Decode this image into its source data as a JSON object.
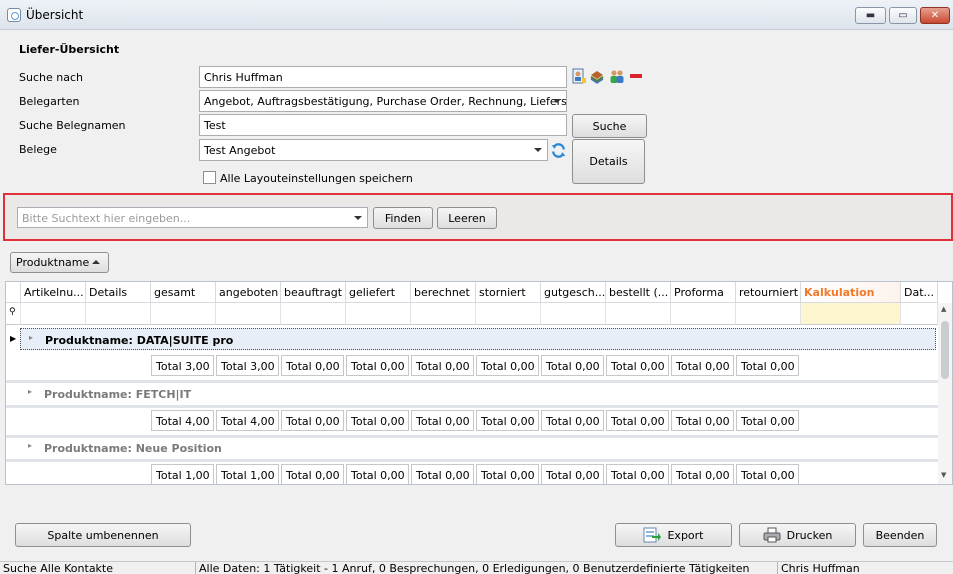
{
  "window": {
    "title": "Übersicht",
    "min": "▬",
    "max": "▭",
    "close": "✕"
  },
  "section_title": "Liefer-Übersicht",
  "form": {
    "search_by_label": "Suche nach",
    "search_by_value": "Chris Huffman",
    "doc_types_label": "Belegarten",
    "doc_types_value": "Angebot, Auftragsbestätigung, Purchase Order, Rechnung, Lieferscheine",
    "doc_name_label": "Suche Belegnamen",
    "doc_name_value": "Test",
    "docs_label": "Belege",
    "docs_value": "Test Angebot",
    "save_layout_label": "Alle Layouteinstellungen speichern",
    "save_layout_checked": false
  },
  "buttons": {
    "search": "Suche",
    "details": "Details",
    "find": "Finden",
    "clear": "Leeren",
    "rename_column": "Spalte umbenennen",
    "export": "Export",
    "print": "Drucken",
    "close": "Beenden"
  },
  "find_panel": {
    "placeholder": "Bitte Suchtext hier eingeben..."
  },
  "group_by": {
    "label": "Produktname"
  },
  "columns": [
    "Artikelnu...",
    "Details",
    "gesamt",
    "angeboten",
    "beauftragt",
    "geliefert",
    "berechnet",
    "storniert",
    "gutgesch...",
    "bestellt (...",
    "Proforma",
    "retourniert",
    "Kalkulation",
    "Dat..."
  ],
  "groups": [
    {
      "label": "Produktname: DATA|SUITE pro",
      "totals": [
        "Total 3,00",
        "Total 3,00",
        "Total 0,00",
        "Total 0,00",
        "Total 0,00",
        "Total 0,00",
        "Total 0,00",
        "Total 0,00",
        "Total 0,00",
        "Total 0,00"
      ]
    },
    {
      "label": "Produktname: FETCH|IT",
      "totals": [
        "Total 4,00",
        "Total 4,00",
        "Total 0,00",
        "Total 0,00",
        "Total 0,00",
        "Total 0,00",
        "Total 0,00",
        "Total 0,00",
        "Total 0,00",
        "Total 0,00"
      ]
    },
    {
      "label": "Produktname: Neue Position",
      "totals": [
        "Total 1,00",
        "Total 1,00",
        "Total 0,00",
        "Total 0,00",
        "Total 0,00",
        "Total 0,00",
        "Total 0,00",
        "Total 0,00",
        "Total 0,00",
        "Total 0,00"
      ]
    }
  ],
  "status": {
    "left": "Suche Alle Kontakte",
    "middle": "Alle Daten: 1 Tätigkeit - 1 Anruf, 0 Besprechungen, 0 Erledigungen, 0 Benutzerdefinierte Tätigkeiten",
    "right": "Chris Huffman"
  },
  "colors": {
    "accent_red": "#e0303a",
    "kalkulation": "#f07a2a",
    "kalkulation_bg": "#fdf6cf",
    "selected_row": "#e8eef8"
  },
  "icons": [
    "app-icon",
    "contact-card-icon",
    "books-icon",
    "people-icon",
    "remove-icon",
    "refresh-icon",
    "export-icon",
    "printer-icon",
    "pin-icon",
    "expand-icon",
    "sort-up-icon"
  ]
}
